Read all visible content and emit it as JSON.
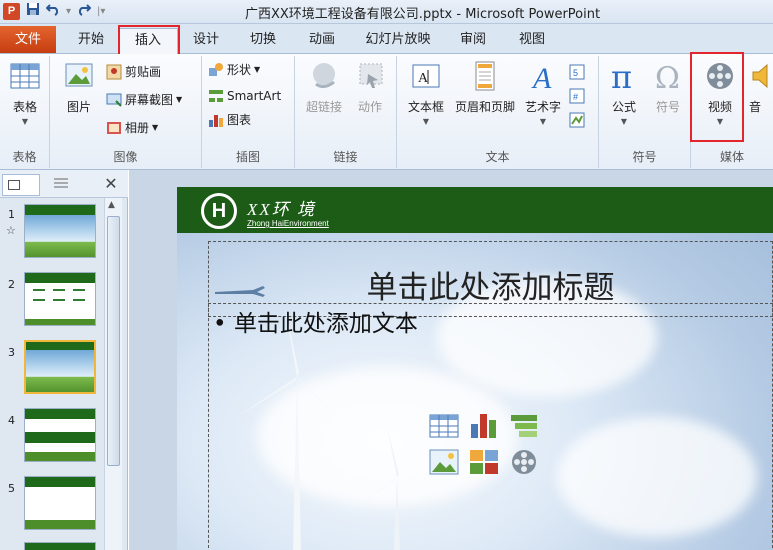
{
  "window": {
    "title": "广西XX环境工程设备有限公司.pptx - Microsoft PowerPoint",
    "app_icon": "P"
  },
  "quick_access": {
    "save_icon": "save-icon",
    "undo_icon": "undo-icon",
    "redo_icon": "redo-icon",
    "customize_icon": "customize-qat-icon"
  },
  "tabs": {
    "file": "文件",
    "home": "开始",
    "insert": "插入",
    "design": "设计",
    "transitions": "切换",
    "animations": "动画",
    "slideshow": "幻灯片放映",
    "review": "审阅",
    "view": "视图"
  },
  "ribbon": {
    "tables": {
      "table_label": "表格",
      "group_label": "表格"
    },
    "images": {
      "picture_label": "图片",
      "clipart_label": "剪贴画",
      "screenshot_label": "屏幕截图",
      "album_label": "相册",
      "group_label": "图像"
    },
    "illustrations": {
      "shapes_label": "形状",
      "smartart_label": "SmartArt",
      "chart_label": "图表",
      "group_label": "插图"
    },
    "links": {
      "hyperlink_label": "超链接",
      "action_label": "动作",
      "group_label": "链接"
    },
    "text": {
      "textbox_label": "文本框",
      "header_footer_label": "页眉和页脚",
      "wordart_label": "艺术字",
      "group_label": "文本"
    },
    "symbols": {
      "equation_label": "公式",
      "symbol_label": "符号",
      "group_label": "符号"
    },
    "media": {
      "video_label": "视频",
      "audio_label": "音",
      "group_label": "媒体"
    }
  },
  "thumbnails": {
    "items": [
      {
        "number": "1",
        "star": "☆"
      },
      {
        "number": "2",
        "star": ""
      },
      {
        "number": "3",
        "star": ""
      },
      {
        "number": "4",
        "star": ""
      },
      {
        "number": "5",
        "star": ""
      }
    ],
    "selected": "3",
    "close_glyph": "✕"
  },
  "slide": {
    "logo_letter": "H",
    "company_title": "XX环 境",
    "company_subtitle": "Zhong HaiEnvironment",
    "title_placeholder": "单击此处添加标题",
    "body_placeholder": "• 单击此处添加文本"
  },
  "colors": {
    "file_tab": "#d24726",
    "highlight_box": "#e2262c",
    "slide_header": "#1d5c16",
    "selected_thumb": "#f0b73a"
  }
}
